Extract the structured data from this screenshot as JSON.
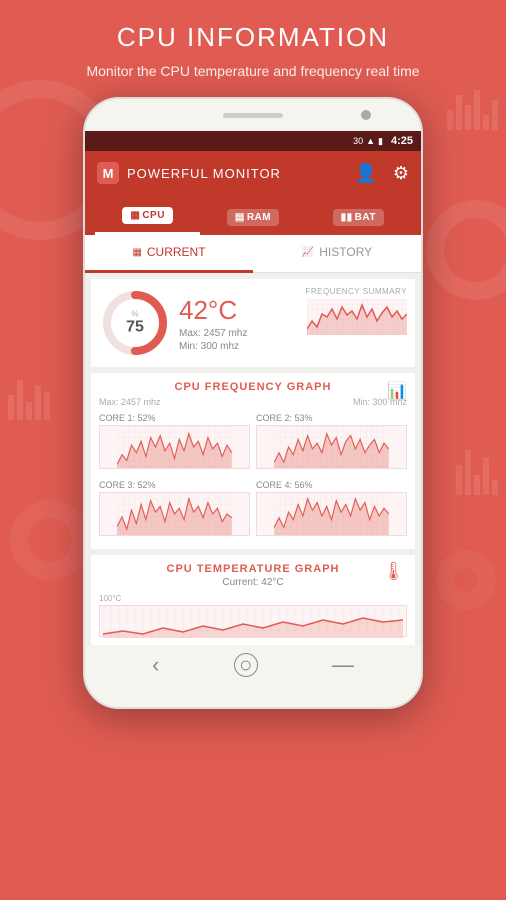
{
  "page": {
    "title": "CPU INFORMATION",
    "subtitle": "Monitor the CPU temperature and frequency real time"
  },
  "statusBar": {
    "time": "4:25",
    "batteryIcon": "🔋",
    "signalIcon": "📶",
    "number": "30"
  },
  "appBar": {
    "logo": "M",
    "name": "POWERFUL MONITOR",
    "personIcon": "👤",
    "settingsIcon": "⚙"
  },
  "tabs": [
    {
      "id": "cpu",
      "label": "CPU",
      "active": true
    },
    {
      "id": "ram",
      "label": "RAM",
      "active": false
    },
    {
      "id": "battery",
      "label": "BAT",
      "active": false
    }
  ],
  "viewTabs": [
    {
      "id": "current",
      "label": "CURRENT",
      "icon": "📊",
      "active": true
    },
    {
      "id": "history",
      "label": "HISTORY",
      "icon": "📈",
      "active": false
    }
  ],
  "summary": {
    "percent": "75",
    "percentLabel": "%",
    "temperature": "42°C",
    "maxFreq": "Max: 2457 mhz",
    "minFreq": "Min: 300 mhz",
    "freqSummaryLabel": "FREQUENCY SUMMARY"
  },
  "cpuFreqGraph": {
    "title": "CPU FREQUENCY GRAPH",
    "maxLabel": "Max: 2457 mhz",
    "minLabel": "Min: 300 mhz",
    "sectionIcon": "📊",
    "cores": [
      {
        "id": 1,
        "label": "CORE 1: 52%"
      },
      {
        "id": 2,
        "label": "CORE 2: 53%"
      },
      {
        "id": 3,
        "label": "CORE 3: 52%"
      },
      {
        "id": 4,
        "label": "CORE 4: 56%"
      }
    ]
  },
  "tempGraph": {
    "title": "CPU TEMPERATURE GRAPH",
    "current": "Current: 42°C",
    "axisLabel": "100°C",
    "icon": "🌡"
  },
  "nav": {
    "back": "‹",
    "home": "○",
    "menu": "—"
  },
  "colors": {
    "primary": "#c0392b",
    "accent": "#e05c52",
    "chartFill": "rgba(224,92,82,0.3)",
    "chartStroke": "#e05c52"
  }
}
